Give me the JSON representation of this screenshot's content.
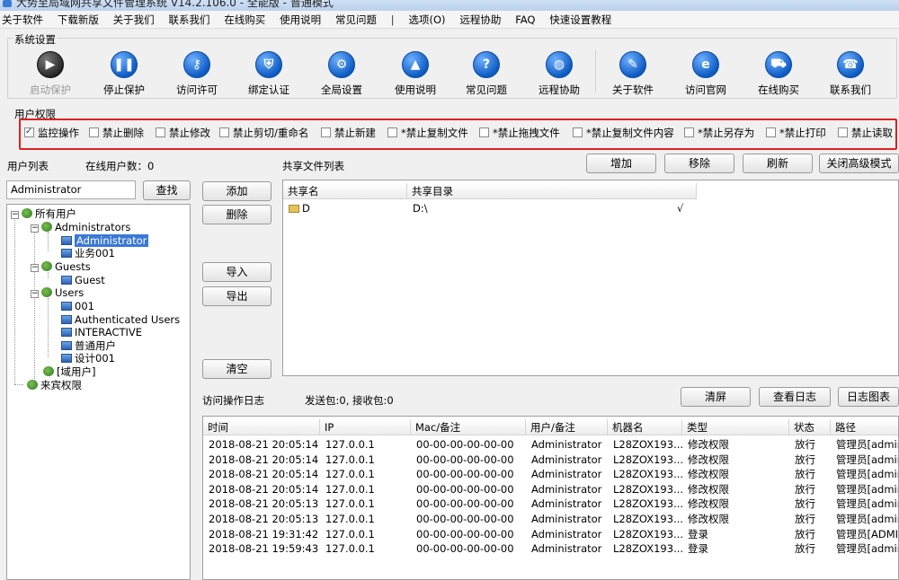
{
  "window": {
    "title": "大势至局域网共享文件管理系统 V14.2.106.0 - 全能版 - 普通模式"
  },
  "menu": [
    "关于软件",
    "下载新版",
    "关于我们",
    "联系我们",
    "在线购买",
    "使用说明",
    "常见问题",
    "|",
    "选项(O)",
    "远程协助",
    "FAQ",
    "快速设置教程"
  ],
  "system_settings": {
    "title": "系统设置",
    "buttons": [
      {
        "label": "启动保护",
        "icon": "play-icon",
        "disabled": true
      },
      {
        "label": "停止保护",
        "icon": "pause-icon"
      },
      {
        "label": "访问许可",
        "icon": "key-icon"
      },
      {
        "label": "绑定认证",
        "icon": "shield-icon"
      },
      {
        "label": "全局设置",
        "icon": "gear-icon"
      },
      {
        "label": "使用说明",
        "icon": "graduation-cap-icon"
      },
      {
        "label": "常见问题",
        "icon": "question-icon"
      },
      {
        "label": "远程协助",
        "icon": "globe-icon"
      },
      {
        "label": "关于软件",
        "icon": "document-icon"
      },
      {
        "label": "访问官网",
        "icon": "ie-icon"
      },
      {
        "label": "在线购买",
        "icon": "cart-icon"
      },
      {
        "label": "联系我们",
        "icon": "phone-icon"
      }
    ]
  },
  "permissions": {
    "title": "用户权限",
    "items": [
      {
        "label": "监控操作",
        "checked": true
      },
      {
        "label": "禁止删除",
        "checked": false
      },
      {
        "label": "禁止修改",
        "checked": false
      },
      {
        "label": "禁止剪切/重命名",
        "checked": false
      },
      {
        "label": "禁止新建",
        "checked": false
      },
      {
        "label": "*禁止复制文件",
        "checked": false
      },
      {
        "label": "*禁止拖拽文件",
        "checked": false
      },
      {
        "label": "*禁止复制文件内容",
        "checked": false
      },
      {
        "label": "*禁止另存为",
        "checked": false
      },
      {
        "label": "*禁止打印",
        "checked": false
      },
      {
        "label": "禁止读取",
        "checked": false
      }
    ]
  },
  "users": {
    "title": "用户列表",
    "online_label": "在线用户数：0",
    "search_value": "Administrator",
    "search_button": "查找",
    "tree": {
      "root": "所有用户",
      "groups": [
        {
          "name": "Administrators",
          "users": [
            "Administrator",
            "业务001"
          ]
        },
        {
          "name": "Guests",
          "users": [
            "Guest"
          ]
        },
        {
          "name": "Users",
          "users": [
            "001",
            "Authenticated Users",
            "INTERACTIVE",
            "普通用户",
            "设计001"
          ]
        }
      ],
      "domain": "[域用户]",
      "guest_perm": "来宾权限"
    },
    "selected": "Administrator"
  },
  "mid_buttons": {
    "add": "添加",
    "delete": "删除",
    "import": "导入",
    "export": "导出",
    "clear": "清空"
  },
  "share": {
    "title": "共享文件列表",
    "buttons": [
      "增加",
      "移除",
      "刷新",
      "关闭高级模式"
    ],
    "columns": [
      "共享名",
      "共享目录"
    ],
    "rows": [
      {
        "name": "D",
        "path": "D:\\",
        "mark": "√"
      }
    ]
  },
  "log": {
    "title": "访问操作日志",
    "packets": "发送包:0, 接收包:0",
    "buttons": [
      "清屏",
      "查看日志",
      "日志图表"
    ],
    "columns": [
      "时间",
      "IP",
      "Mac/备注",
      "用户/备注",
      "机器名",
      "类型",
      "状态",
      "路径"
    ],
    "rows": [
      [
        "2018-08-21 20:05:14",
        "127.0.0.1",
        "00-00-00-00-00-00",
        "Administrator",
        "L28ZOX193...",
        "修改权限",
        "放行",
        "管理员[admin]"
      ],
      [
        "2018-08-21 20:05:14",
        "127.0.0.1",
        "00-00-00-00-00-00",
        "Administrator",
        "L28ZOX193...",
        "修改权限",
        "放行",
        "管理员[admin]"
      ],
      [
        "2018-08-21 20:05:14",
        "127.0.0.1",
        "00-00-00-00-00-00",
        "Administrator",
        "L28ZOX193...",
        "修改权限",
        "放行",
        "管理员[admin]"
      ],
      [
        "2018-08-21 20:05:14",
        "127.0.0.1",
        "00-00-00-00-00-00",
        "Administrator",
        "L28ZOX193...",
        "修改权限",
        "放行",
        "管理员[admin]"
      ],
      [
        "2018-08-21 20:05:13",
        "127.0.0.1",
        "00-00-00-00-00-00",
        "Administrator",
        "L28ZOX193...",
        "修改权限",
        "放行",
        "管理员[admin]"
      ],
      [
        "2018-08-21 20:05:13",
        "127.0.0.1",
        "00-00-00-00-00-00",
        "Administrator",
        "L28ZOX193...",
        "修改权限",
        "放行",
        "管理员[admin]"
      ],
      [
        "2018-08-21 19:31:42",
        "127.0.0.1",
        "00-00-00-00-00-00",
        "Administrator",
        "L28ZOX193...",
        "登录",
        "放行",
        "管理员[ADMIN]"
      ],
      [
        "2018-08-21 19:59:43",
        "127.0.0.1",
        "00-00-00-00-00-00",
        "Administrator",
        "L28ZOX193...",
        "登录",
        "放行",
        "管理员[admin]"
      ]
    ]
  }
}
